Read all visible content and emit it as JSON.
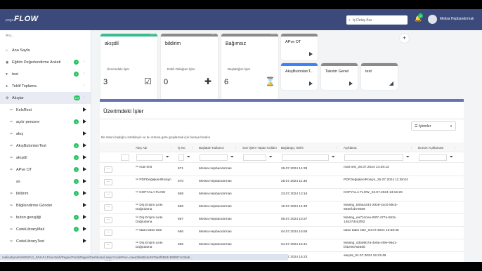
{
  "header": {
    "brand_small": "pnga",
    "brand_name": "FLOW",
    "search_placeholder": "İş Detay Ara",
    "notification_count": "0",
    "user_name": "Melisa Hepbandırmalı"
  },
  "sidebar": {
    "search_placeholder": "Ara...",
    "items": [
      {
        "label": "Ana Sayfa",
        "icon": "home-icon",
        "glyph": "⌂",
        "badge": "",
        "chevron": false,
        "play": false,
        "sub": false,
        "active": false
      },
      {
        "label": "Eğitim Değerlendirme Anketi",
        "icon": "form-icon",
        "glyph": "◉",
        "badge": "7",
        "chevron": true,
        "play": false,
        "sub": false,
        "active": false
      },
      {
        "label": "test",
        "icon": "heart-icon",
        "glyph": "♥",
        "badge": "3",
        "chevron": true,
        "play": false,
        "sub": false,
        "active": false
      },
      {
        "label": "Teklif Toplama",
        "icon": "offer-icon",
        "glyph": "●",
        "badge": "",
        "chevron": true,
        "play": false,
        "sub": false,
        "active": false
      },
      {
        "label": "Akışlar",
        "icon": "flow-icon",
        "glyph": "⚙",
        "badge": "102",
        "chevron": true,
        "play": false,
        "sub": false,
        "active": true
      },
      {
        "label": "KelsRest",
        "icon": "tools-icon",
        "glyph": "✂",
        "badge": "",
        "chevron": false,
        "play": true,
        "sub": true,
        "active": false
      },
      {
        "label": "açılır pencere",
        "icon": "tools-icon",
        "glyph": "✂",
        "badge": "1",
        "chevron": false,
        "play": true,
        "sub": true,
        "active": false
      },
      {
        "label": "akış",
        "icon": "tools-icon",
        "glyph": "✂",
        "badge": "",
        "chevron": false,
        "play": true,
        "sub": true,
        "active": false
      },
      {
        "label": "AkışButonlarıTest",
        "icon": "tools-icon",
        "glyph": "✂",
        "badge": "3",
        "chevron": false,
        "play": true,
        "sub": true,
        "active": false
      },
      {
        "label": "akışdil",
        "icon": "tools-icon",
        "glyph": "✂",
        "badge": "3",
        "chevron": false,
        "play": true,
        "sub": true,
        "active": false
      },
      {
        "label": "APve OT",
        "icon": "tools-icon",
        "glyph": "✂",
        "badge": "1",
        "chevron": false,
        "play": true,
        "sub": true,
        "active": false
      },
      {
        "label": "as",
        "icon": "tools-icon",
        "glyph": "",
        "badge": "1",
        "chevron": false,
        "play": true,
        "sub": true,
        "active": false
      },
      {
        "label": "bildirim",
        "icon": "tools-icon",
        "glyph": "✂",
        "badge": "1",
        "chevron": false,
        "play": true,
        "sub": true,
        "active": false
      },
      {
        "label": "Bilgilendirme Gönder",
        "icon": "tools-icon",
        "glyph": "✂",
        "badge": "",
        "chevron": false,
        "play": true,
        "sub": true,
        "active": false
      },
      {
        "label": "buton genişliği",
        "icon": "tools-icon",
        "glyph": "✂",
        "badge": "1",
        "chevron": false,
        "play": true,
        "sub": true,
        "active": false
      },
      {
        "label": "CodeLibraryMail",
        "icon": "tools-icon",
        "glyph": "✂",
        "badge": "1",
        "chevron": false,
        "play": true,
        "sub": true,
        "active": false
      },
      {
        "label": "CodeLibraryTest",
        "icon": "tools-icon",
        "glyph": "✂",
        "badge": "",
        "chevron": false,
        "play": true,
        "sub": true,
        "active": false
      }
    ]
  },
  "status_url": "melisahpndrml8282/v1_0/NAF.LFlow.Web/Pages/PortalPages/Dashboard.aspx?codePrev=caea3fe84b4e4975a6f58531890f874c3bab...",
  "tiles": {
    "large": [
      {
        "title": "akışdil",
        "sub": "Üzerimdeki İşler",
        "count": "3",
        "icon": "task-check-icon",
        "glyph": "☑",
        "color": "#3cba92"
      },
      {
        "title": "bildirim",
        "sub": "Dahil Olduğum İşler",
        "count": "0",
        "icon": "user-add-icon",
        "glyph": "✚",
        "color": "#8a8a8a"
      },
      {
        "title": "Bağımsız",
        "sub": "Başlattığım İşler",
        "count": "6",
        "icon": "hourglass-icon",
        "glyph": "⌛",
        "color": "#8a8a8a"
      }
    ],
    "small": [
      {
        "title": "APve OT",
        "color": "#8a8a8a",
        "icon": "play-icon"
      },
      {
        "title": "AkışButonlarıT...",
        "color": "#3b82f6",
        "icon": "play-icon"
      },
      {
        "title": "Takvim Genel",
        "color": "#8a8a8a",
        "icon": "play-icon"
      },
      {
        "title": "test",
        "color": "#8a8a8a",
        "icon": "chart-icon"
      }
    ]
  },
  "panel": {
    "title": "Üzerimdeki İşler",
    "actions_label": "İşlemler",
    "group_hint": "Bir sütun başlığını sürükleyin ve bu sütuna göre gruplamak için buraya bırakın",
    "columns": [
      "",
      "Akış Adı",
      "İş No",
      "Başlatan Kullanıcı",
      "Son İşlem Yapan Kullanıcı",
      "Başlangıç Tarihi",
      "Açıklama",
      "Durum Açıklaması"
    ],
    "rows": [
      {
        "flow": "mail test",
        "no": "671",
        "user": "Melisa Hepbandırmalı",
        "date": "26.07.2024 14:39",
        "desc": "mail test_26.07.2024 14:39:13"
      },
      {
        "flow": "PDFDeğişkenlRosiyn",
        "no": "670",
        "user": "Melisa Hepbandırmalı",
        "date": "25.07.2024 11:38",
        "desc": "PDFDeğişkenlRosiyn_25.07.2024 11:38:04"
      },
      {
        "flow": "KOPYALA FLOW",
        "no": "669",
        "user": "Melisa Hepbandırmalı",
        "date": "23.07.2024 13:16",
        "desc": "KOPYALA FLOW_23.07.2024 13:16:29"
      },
      {
        "flow": "Dış Erişim Linki Doğrulama",
        "no": "668",
        "user": "Melisa Hepbandırmalı",
        "date": "10.07.2024 14:49",
        "desc": "Mailing_b06a4244-2928-44c0-89cb-656ef1b73089"
      },
      {
        "flow": "Dış Erişim Linki Doğrulama",
        "no": "667",
        "user": "Melisa Hepbandırmalı",
        "date": "05.07.2024 10:37",
        "desc": "Mailing_ea71dcea-08f7-477a-b53c-14627dc52f92"
      },
      {
        "flow": "tablo tablo liste",
        "no": "666",
        "user": "Melisa Hepbandırmalı",
        "date": "04.07.2024 15:58",
        "desc": "tablo tablo liste_04.07.2024 15:58:45"
      },
      {
        "flow": "Dış Erişim Linki Doğrulama",
        "no": "665",
        "user": "Melisa Hepbandırmalı",
        "date": "04.07.2024 15:41",
        "desc": "Mailing_d3bb9b7a-4e8a-4f9e-95d1-bf1e067626d6"
      },
      {
        "flow": "akış",
        "no": "664",
        "user": "Melisa Hepbandırmalı",
        "date": "04.07.2024 15:23",
        "desc": "akışdil_04.07.2024 15:23:49"
      }
    ]
  }
}
